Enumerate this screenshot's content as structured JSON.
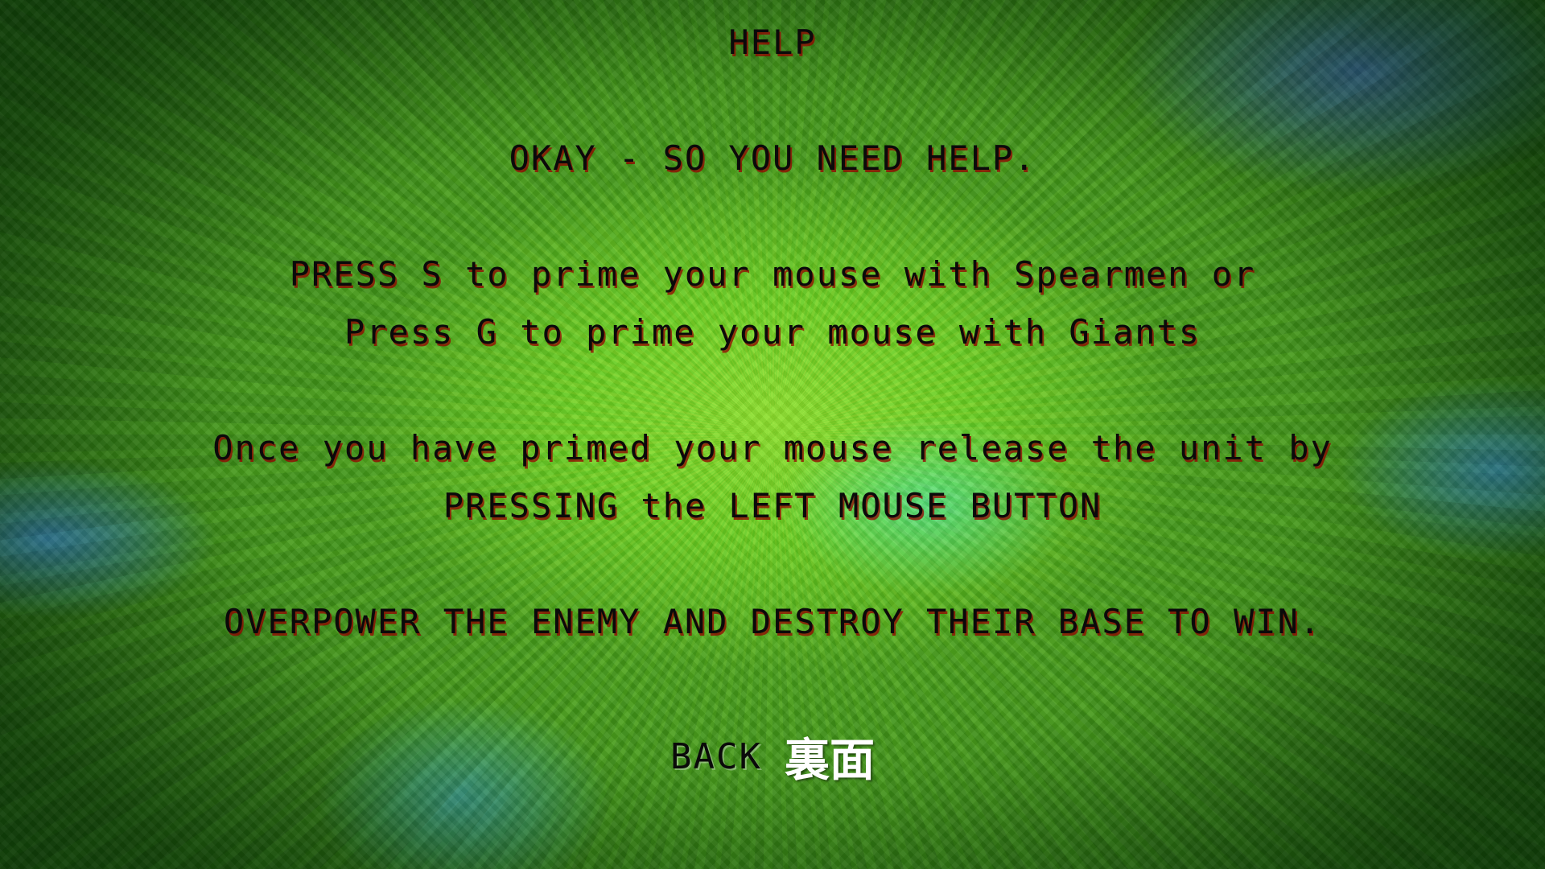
{
  "screen": {
    "title": "HELP",
    "lines": [
      "OKAY - SO YOU NEED HELP.",
      "PRESS S to prime your mouse with Spearmen or",
      "Press G to prime your mouse with Giants",
      "Once you have primed your mouse release the unit by",
      "PRESSING the LEFT MOUSE BUTTON",
      "OVERPOWER THE ENEMY AND DESTROY THEIR BASE TO WIN."
    ]
  },
  "back_button": {
    "label": "BACK",
    "label_jp": "裏面"
  },
  "colors": {
    "text": "#0a0a0a",
    "text_shadow": "#960000",
    "back_jp_text": "#ffffff",
    "background_primary": "#6fcf22",
    "background_accent": "#46ebc8"
  }
}
